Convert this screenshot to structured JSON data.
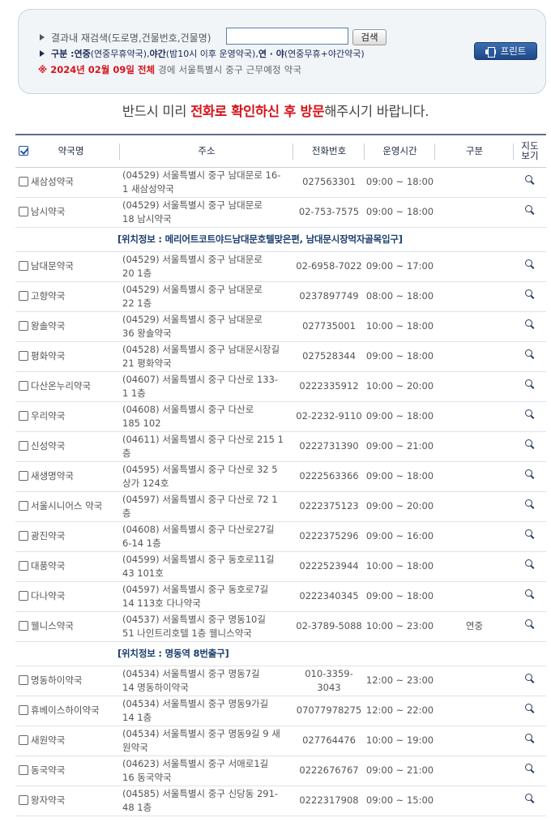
{
  "search": {
    "label": "결과내 재검색(도로명,건물번호,건물명)",
    "value": "",
    "button": "검색",
    "legend": {
      "prefix": "구분 : ",
      "a_b": "연중",
      "a_n": "(연중무휴약국), ",
      "b_b": "야간",
      "b_n": "(밤10시 이후 운영약국), ",
      "c_b": "연 · 야",
      "c_n": "(연중무휴+야간약국)"
    },
    "date_line": {
      "mark": "※",
      "date": "2024년 02월 09일 전체",
      "rest": "경에  서울특별시  중구   근무예정 약국"
    }
  },
  "print_button": "프린트",
  "notice": {
    "pre": "반드시 미리 ",
    "highlight": "전화로 확인하신 후 방문",
    "post": "해주시기 바랍니다."
  },
  "columns": {
    "name": "약국명",
    "address": "주소",
    "tel": "전화번호",
    "hours": "운영시간",
    "kind": "구분",
    "map_l1": "지도",
    "map_l2": "보기"
  },
  "rows": [
    {
      "name": "새삼성약국",
      "addr1": "(04529) 서울특별시 중구 남대문로 16-",
      "addr2": "1 새삼성약국",
      "tel": "027563301",
      "hours": "09:00 ~ 18:00",
      "kind": ""
    },
    {
      "name": "남시약국",
      "addr1": "(04529) 서울특별시 중구 남대문로",
      "addr2": "18 남시약국",
      "tel": "02-753-7575",
      "hours": "09:00 ~ 18:00",
      "kind": ""
    },
    {
      "name": "남대문약국",
      "addr1": "(04529) 서울특별시 중구 남대문로",
      "addr2": "20 1층",
      "tel": "02-6958-7022",
      "hours": "09:00 ~ 17:00",
      "kind": ""
    },
    {
      "name": "고향약국",
      "addr1": "(04529) 서울특별시 중구 남대문로",
      "addr2": "22 1층",
      "tel": "0237897749",
      "hours": "08:00 ~ 18:00",
      "kind": ""
    },
    {
      "name": "왕솔약국",
      "addr1": "(04529) 서울특별시 중구 남대문로",
      "addr2": "36 왕솔약국",
      "tel": "027735001",
      "hours": "10:00 ~ 18:00",
      "kind": ""
    },
    {
      "name": "평화약국",
      "addr1": "(04528) 서울특별시 중구 남대문시장길",
      "addr2": "21 평화약국",
      "tel": "027528344",
      "hours": "09:00 ~ 18:00",
      "kind": ""
    },
    {
      "name": "다산온누리약국",
      "addr1": "(04607) 서울특별시 중구 다산로 133-",
      "addr2": "1 1층",
      "tel": "0222335912",
      "hours": "10:00 ~ 20:00",
      "kind": ""
    },
    {
      "name": "우리약국",
      "addr1": "(04608) 서울특별시 중구 다산로",
      "addr2": "185 102",
      "tel": "02-2232-9110",
      "hours": "09:00 ~ 18:00",
      "kind": ""
    },
    {
      "name": "신성약국",
      "addr1": "(04611) 서울특별시 중구 다산로 215 1",
      "addr2": "층",
      "tel": "0222731390",
      "hours": "09:00 ~ 21:00",
      "kind": ""
    },
    {
      "name": "새생명약국",
      "addr1": "(04595) 서울특별시 중구 다산로 32 5",
      "addr2": "상가 124호",
      "tel": "0222563366",
      "hours": "09:00 ~ 18:00",
      "kind": ""
    },
    {
      "name": "서울시니어스 약국",
      "addr1": "(04597) 서울특별시 중구 다산로 72 1",
      "addr2": "층",
      "tel": "0222375123",
      "hours": "09:00 ~ 20:00",
      "kind": ""
    },
    {
      "name": "광진약국",
      "addr1": "(04608) 서울특별시 중구 다산로27길",
      "addr2": "6-14 1층",
      "tel": "0222375296",
      "hours": "09:00 ~ 16:00",
      "kind": ""
    },
    {
      "name": "대풍약국",
      "addr1": "(04599) 서울특별시 중구 동호로11길",
      "addr2": "43 101호",
      "tel": "0222523944",
      "hours": "10:00 ~ 18:00",
      "kind": ""
    },
    {
      "name": "다나약국",
      "addr1": "(04597) 서울특별시 중구 동호로7길",
      "addr2": "14 113호 다나약국",
      "tel": "0222340345",
      "hours": "09:00 ~ 18:00",
      "kind": ""
    },
    {
      "name": "웰니스약국",
      "addr1": "(04537) 서울특별시 중구 명동10길",
      "addr2": "51 나인트리호텔 1층 웰니스약국",
      "tel": "02-3789-5088",
      "hours": "10:00 ~ 23:00",
      "kind": "연중"
    },
    {
      "name": "명동하이약국",
      "addr1": "(04534) 서울특별시 중구 명동7길",
      "addr2": "14 명동하이약국",
      "tel": "010-3359-3043",
      "hours": "12:00 ~ 23:00",
      "kind": ""
    },
    {
      "name": "휴베이스하이약국",
      "addr1": "(04534) 서울특별시 중구 명동9가길",
      "addr2": "14 1층",
      "tel": "07077978275",
      "hours": "12:00 ~ 22:00",
      "kind": ""
    },
    {
      "name": "새원약국",
      "addr1": "(04534) 서울특별시 중구 명동9길 9 새",
      "addr2": "원약국",
      "tel": "027764476",
      "hours": "10:00 ~ 19:00",
      "kind": ""
    },
    {
      "name": "동국약국",
      "addr1": "(04623) 서울특별시 중구 서애로1길",
      "addr2": "16 동국약국",
      "tel": "0222676767",
      "hours": "09:00 ~ 21:00",
      "kind": ""
    },
    {
      "name": "왕자약국",
      "addr1": "(04585) 서울특별시 중구 신당동 291-",
      "addr2": "48 1층",
      "tel": "0222317908",
      "hours": "09:00 ~ 15:00",
      "kind": ""
    }
  ],
  "location_notes": [
    {
      "after_row": 1,
      "text": "[위치정보 : 메리어트코트야드남대문호텔맞은편, 남대문시장먹자골목입구]"
    },
    {
      "after_row": 14,
      "text": "[위치정보 : 명동역 8번출구]"
    }
  ],
  "icons": {
    "search_mode": "triangle-arrow-icon",
    "print": "printer-icon",
    "map": "magnifier-icon"
  }
}
